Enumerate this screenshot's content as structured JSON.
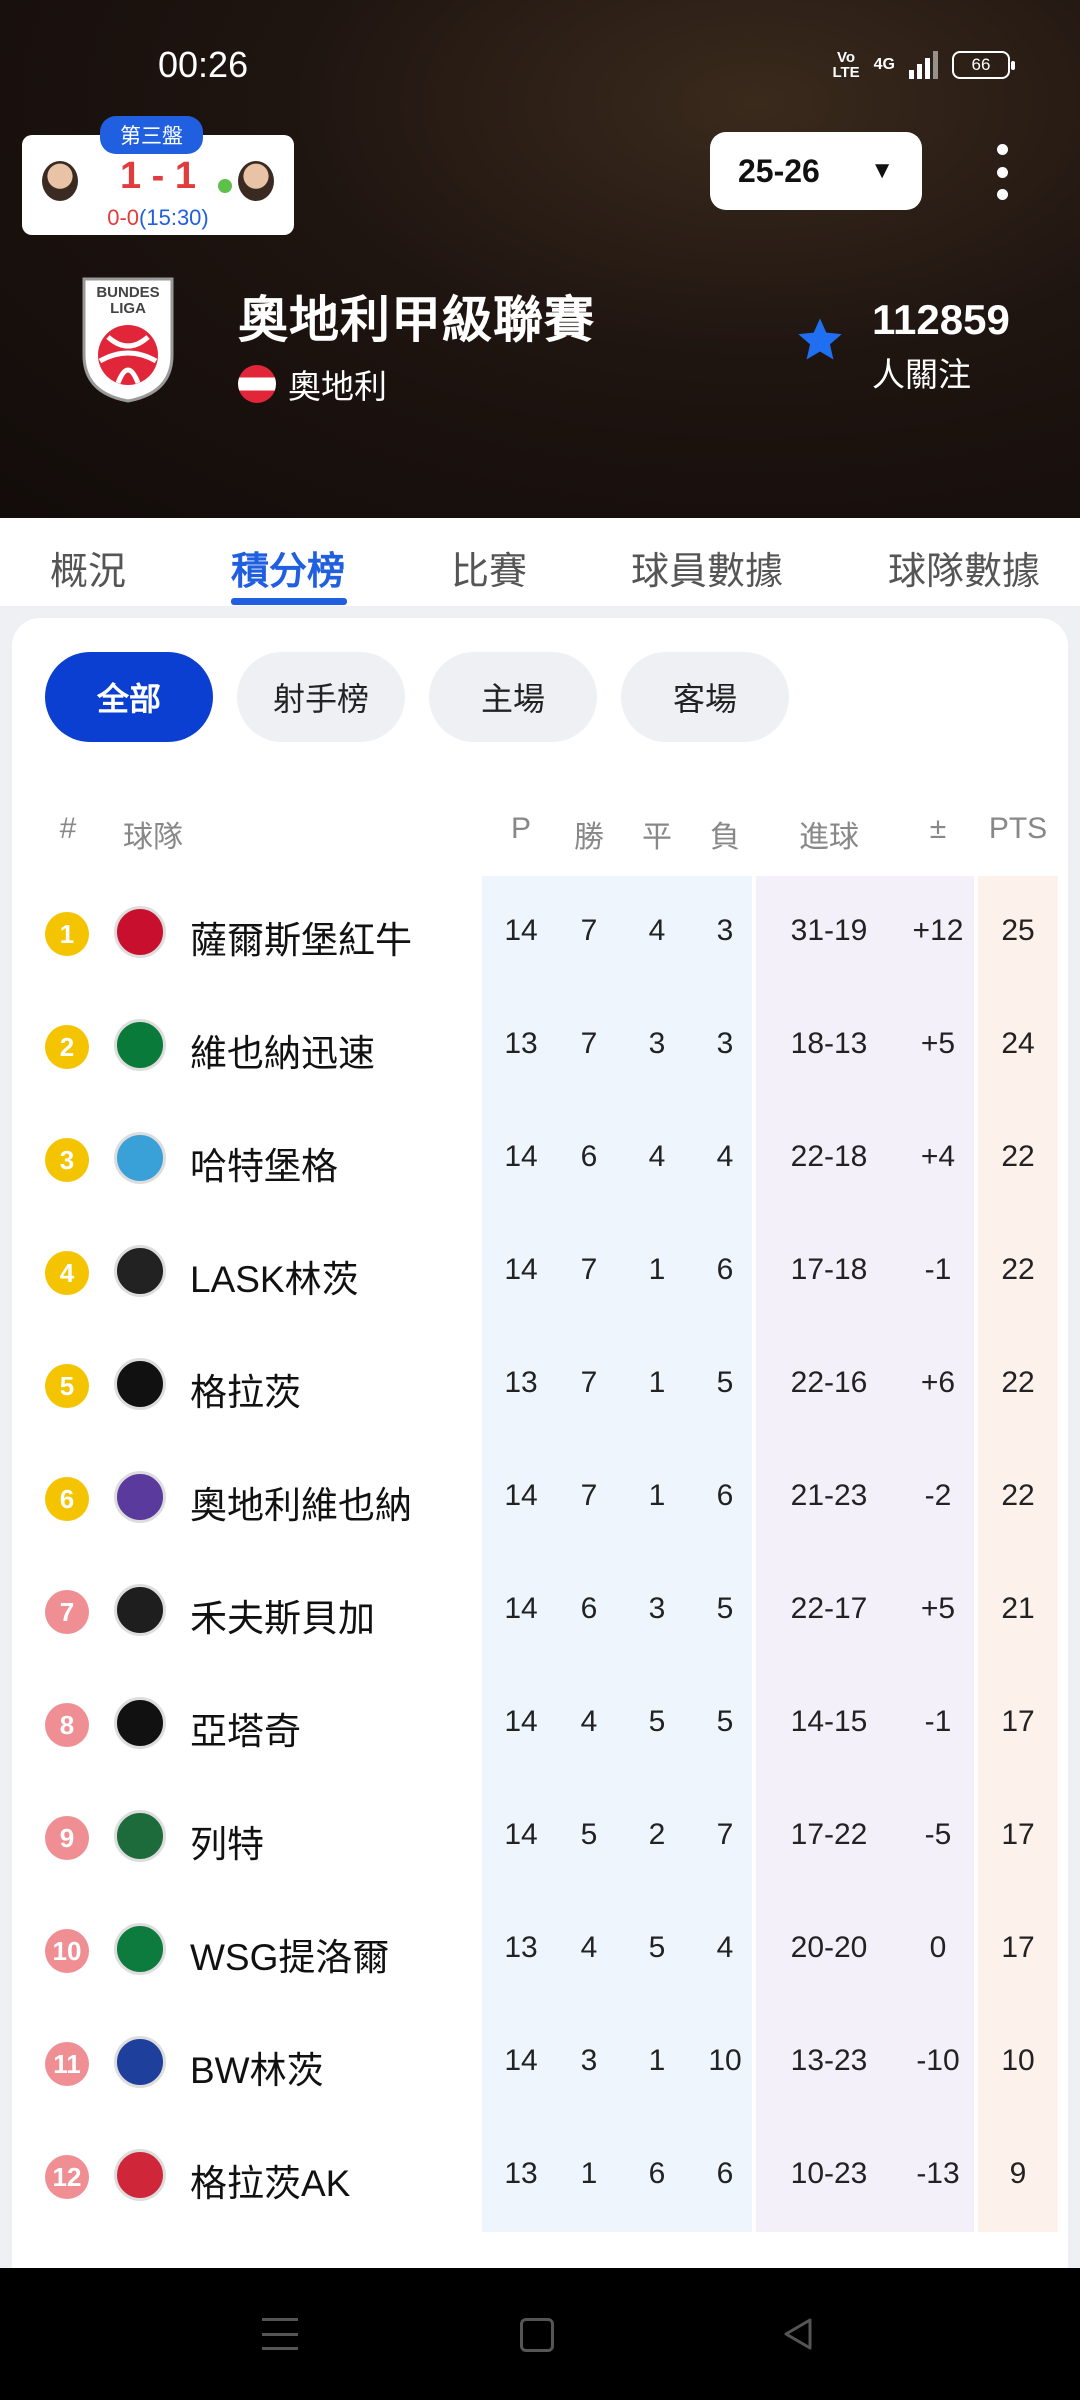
{
  "status": {
    "time": "00:26",
    "volte": "Vo\nLTE",
    "network": "4G",
    "battery": "66"
  },
  "live": {
    "badge": "第三盤",
    "score": "1 - 1",
    "sub_score": "0-0",
    "sub_time": "(15:30)"
  },
  "season": {
    "value": "25-26",
    "caret": "▼"
  },
  "league": {
    "name": "奧地利甲級聯賽",
    "country": "奧地利",
    "followers": "112859",
    "followers_label": "人關注",
    "logo_text": "BUNDES LIGA"
  },
  "tabs": [
    "概況",
    "積分榜",
    "比賽",
    "球員數據",
    "球隊數據"
  ],
  "filters": [
    "全部",
    "射手榜",
    "主場",
    "客場"
  ],
  "table": {
    "headers": {
      "rank": "#",
      "team": "球隊",
      "p": "P",
      "w": "勝",
      "d": "平",
      "l": "負",
      "goals": "進球",
      "diff": "±",
      "pts": "PTS"
    },
    "rows": [
      {
        "rank": "1",
        "team": "薩爾斯堡紅牛",
        "p": "14",
        "w": "7",
        "d": "4",
        "l": "3",
        "goals": "31-19",
        "diff": "+12",
        "pts": "25",
        "color": "#c8102e"
      },
      {
        "rank": "2",
        "team": "維也納迅速",
        "p": "13",
        "w": "7",
        "d": "3",
        "l": "3",
        "goals": "18-13",
        "diff": "+5",
        "pts": "24",
        "color": "#0a7a3a"
      },
      {
        "rank": "3",
        "team": "哈特堡格",
        "p": "14",
        "w": "6",
        "d": "4",
        "l": "4",
        "goals": "22-18",
        "diff": "+4",
        "pts": "22",
        "color": "#3aa0d8"
      },
      {
        "rank": "4",
        "team": "LASK林茨",
        "p": "14",
        "w": "7",
        "d": "1",
        "l": "6",
        "goals": "17-18",
        "diff": "-1",
        "pts": "22",
        "color": "#222222"
      },
      {
        "rank": "5",
        "team": "格拉茨",
        "p": "13",
        "w": "7",
        "d": "1",
        "l": "5",
        "goals": "22-16",
        "diff": "+6",
        "pts": "22",
        "color": "#111111"
      },
      {
        "rank": "6",
        "team": "奧地利維也納",
        "p": "14",
        "w": "7",
        "d": "1",
        "l": "6",
        "goals": "21-23",
        "diff": "-2",
        "pts": "22",
        "color": "#5a3a9c"
      },
      {
        "rank": "7",
        "team": "禾夫斯貝加",
        "p": "14",
        "w": "6",
        "d": "3",
        "l": "5",
        "goals": "22-17",
        "diff": "+5",
        "pts": "21",
        "color": "#1e1e1e"
      },
      {
        "rank": "8",
        "team": "亞塔奇",
        "p": "14",
        "w": "4",
        "d": "5",
        "l": "5",
        "goals": "14-15",
        "diff": "-1",
        "pts": "17",
        "color": "#111111"
      },
      {
        "rank": "9",
        "team": "列特",
        "p": "14",
        "w": "5",
        "d": "2",
        "l": "7",
        "goals": "17-22",
        "diff": "-5",
        "pts": "17",
        "color": "#1d6b3a"
      },
      {
        "rank": "10",
        "team": "WSG提洛爾",
        "p": "13",
        "w": "4",
        "d": "5",
        "l": "4",
        "goals": "20-20",
        "diff": "0",
        "pts": "17",
        "color": "#0d7a3e"
      },
      {
        "rank": "11",
        "team": "BW林茨",
        "p": "14",
        "w": "3",
        "d": "1",
        "l": "10",
        "goals": "13-23",
        "diff": "-10",
        "pts": "10",
        "color": "#1f3f9c"
      },
      {
        "rank": "12",
        "team": "格拉茨AK",
        "p": "13",
        "w": "1",
        "d": "6",
        "l": "6",
        "goals": "10-23",
        "diff": "-13",
        "pts": "9",
        "color": "#d0263a"
      }
    ]
  },
  "icons": {
    "star": "star-icon",
    "more": "more-vertical-icon",
    "nav": [
      "menu-icon",
      "home-icon",
      "back-icon"
    ]
  },
  "colors": {
    "accent": "#1f5fe0",
    "filter_active": "#0a3fd1",
    "rank_top": "#f5c400",
    "rank_low": "#ef8f94"
  }
}
